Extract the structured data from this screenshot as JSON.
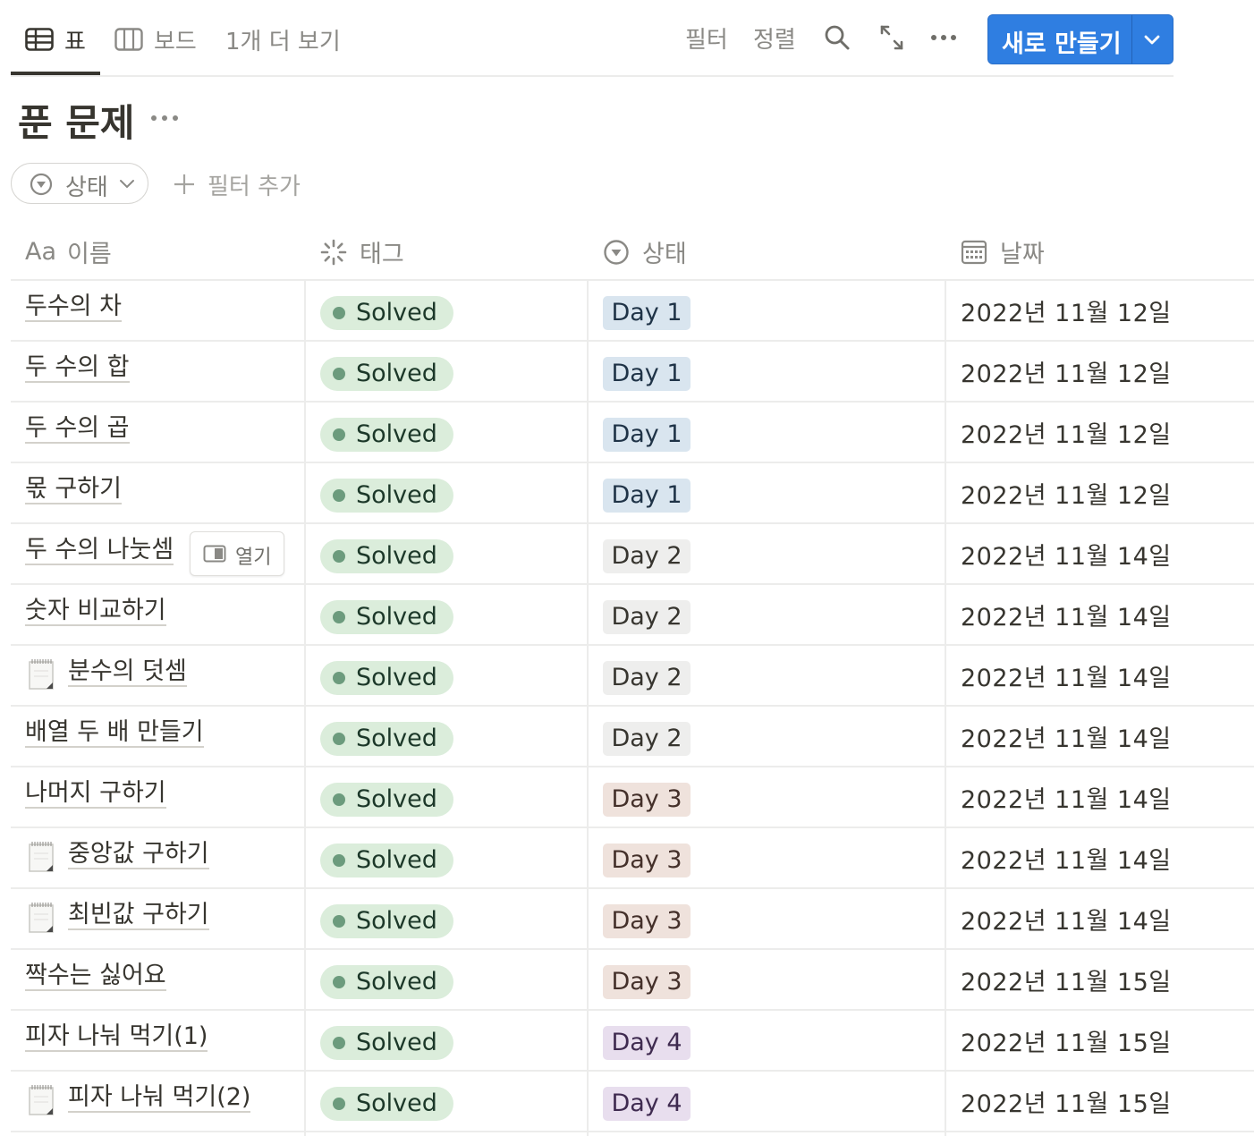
{
  "tabs": [
    {
      "label": "표",
      "icon": "table-icon",
      "active": true
    },
    {
      "label": "보드",
      "icon": "board-icon",
      "active": false
    }
  ],
  "more_views": "1개 더 보기",
  "toolbar": {
    "filter": "필터",
    "sort": "정렬",
    "new_button": "새로 만들기"
  },
  "title": "푼 문제",
  "filter_chip": "상태",
  "add_filter": "필터 추가",
  "columns": {
    "name": "이름",
    "name_icon_text": "Aa",
    "tag": "태그",
    "status": "상태",
    "date": "날짜"
  },
  "open_button": "열기",
  "rows": [
    {
      "name": "두수의 차",
      "has_icon": false,
      "tag": "Solved",
      "status": "Day 1",
      "date": "2022년 11월 12일"
    },
    {
      "name": "두 수의 합",
      "has_icon": false,
      "tag": "Solved",
      "status": "Day 1",
      "date": "2022년 11월 12일"
    },
    {
      "name": "두 수의 곱",
      "has_icon": false,
      "tag": "Solved",
      "status": "Day 1",
      "date": "2022년 11월 12일"
    },
    {
      "name": "몫 구하기",
      "has_icon": false,
      "tag": "Solved",
      "status": "Day 1",
      "date": "2022년 11월 12일"
    },
    {
      "name": "두 수의 나눗셈",
      "has_icon": false,
      "tag": "Solved",
      "status": "Day 2",
      "date": "2022년 11월 14일"
    },
    {
      "name": "숫자 비교하기",
      "has_icon": false,
      "tag": "Solved",
      "status": "Day 2",
      "date": "2022년 11월 14일"
    },
    {
      "name": "분수의 덧셈",
      "has_icon": true,
      "tag": "Solved",
      "status": "Day 2",
      "date": "2022년 11월 14일"
    },
    {
      "name": "배열 두 배 만들기",
      "has_icon": false,
      "tag": "Solved",
      "status": "Day 2",
      "date": "2022년 11월 14일"
    },
    {
      "name": "나머지 구하기",
      "has_icon": false,
      "tag": "Solved",
      "status": "Day 3",
      "date": "2022년 11월 14일"
    },
    {
      "name": "중앙값 구하기",
      "has_icon": true,
      "tag": "Solved",
      "status": "Day 3",
      "date": "2022년 11월 14일"
    },
    {
      "name": "최빈값 구하기",
      "has_icon": true,
      "tag": "Solved",
      "status": "Day 3",
      "date": "2022년 11월 14일"
    },
    {
      "name": "짝수는 싫어요",
      "has_icon": false,
      "tag": "Solved",
      "status": "Day 3",
      "date": "2022년 11월 15일"
    },
    {
      "name": "피자 나눠 먹기(1)",
      "has_icon": false,
      "tag": "Solved",
      "status": "Day 4",
      "date": "2022년 11월 15일"
    },
    {
      "name": "피자 나눠 먹기(2)",
      "has_icon": true,
      "tag": "Solved",
      "status": "Day 4",
      "date": "2022년 11월 15일"
    }
  ],
  "colors": {
    "accent": "#2f7ee1",
    "tag_solved_bg": "#dbeddb",
    "day1": "#d9e5ef",
    "day2": "#eeeeed",
    "day3": "#efe2dc",
    "day4": "#e8deee"
  }
}
